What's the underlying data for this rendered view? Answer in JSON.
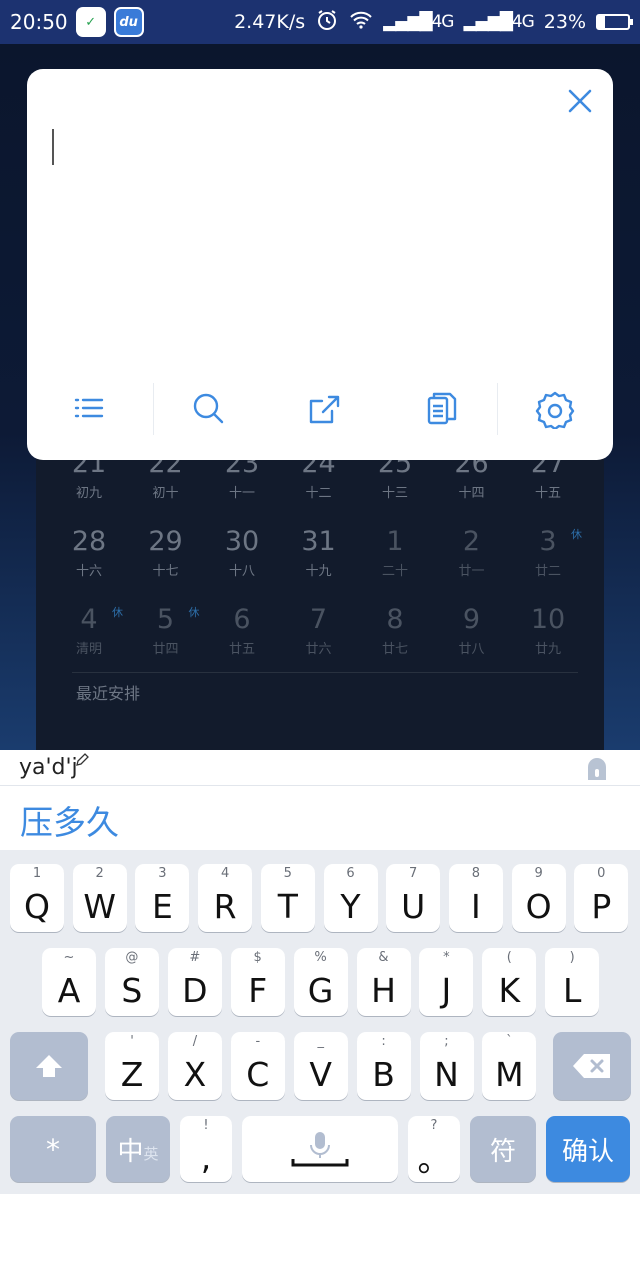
{
  "status_bar": {
    "time": "20:50",
    "app_china_mobile": "✓",
    "app_du": "du",
    "network_speed": "2.47K/s",
    "signal1": "4G",
    "signal2": "4G",
    "battery": "23%",
    "battery_level": 0.23
  },
  "calendar": {
    "rows": [
      [
        {
          "n": "21",
          "l": "初九"
        },
        {
          "n": "22",
          "l": "初十"
        },
        {
          "n": "23",
          "l": "十一"
        },
        {
          "n": "24",
          "l": "十二"
        },
        {
          "n": "25",
          "l": "十三"
        },
        {
          "n": "26",
          "l": "十四"
        },
        {
          "n": "27",
          "l": "十五"
        }
      ],
      [
        {
          "n": "28",
          "l": "十六"
        },
        {
          "n": "29",
          "l": "十七"
        },
        {
          "n": "30",
          "l": "十八"
        },
        {
          "n": "31",
          "l": "十九"
        },
        {
          "n": "1",
          "l": "二十"
        },
        {
          "n": "2",
          "l": "廿一"
        },
        {
          "n": "3",
          "l": "廿二",
          "h": "休"
        }
      ],
      [
        {
          "n": "4",
          "l": "清明",
          "h": "休"
        },
        {
          "n": "5",
          "l": "廿四",
          "h": "休"
        },
        {
          "n": "6",
          "l": "廿五"
        },
        {
          "n": "7",
          "l": "廿六"
        },
        {
          "n": "8",
          "l": "廿七"
        },
        {
          "n": "9",
          "l": "廿八"
        },
        {
          "n": "10",
          "l": "廿九"
        }
      ]
    ],
    "recent_label": "最近安排"
  },
  "note": {
    "close_icon": "close-icon",
    "tools": [
      "list-icon",
      "search-icon",
      "share-icon",
      "copy-icon",
      "settings-icon"
    ]
  },
  "ime": {
    "pinyin": "ya'd'j",
    "candidate": "压多久",
    "rows": [
      [
        {
          "k": "Q",
          "s": "1"
        },
        {
          "k": "W",
          "s": "2"
        },
        {
          "k": "E",
          "s": "3"
        },
        {
          "k": "R",
          "s": "4"
        },
        {
          "k": "T",
          "s": "5"
        },
        {
          "k": "Y",
          "s": "6"
        },
        {
          "k": "U",
          "s": "7"
        },
        {
          "k": "I",
          "s": "8"
        },
        {
          "k": "O",
          "s": "9"
        },
        {
          "k": "P",
          "s": "0"
        }
      ],
      [
        {
          "k": "A",
          "s": "~"
        },
        {
          "k": "S",
          "s": "@"
        },
        {
          "k": "D",
          "s": "#"
        },
        {
          "k": "F",
          "s": "$"
        },
        {
          "k": "G",
          "s": "%"
        },
        {
          "k": "H",
          "s": "&"
        },
        {
          "k": "J",
          "s": "*"
        },
        {
          "k": "K",
          "s": "("
        },
        {
          "k": "L",
          "s": ")"
        }
      ],
      [
        {
          "k": "Z",
          "s": "'"
        },
        {
          "k": "X",
          "s": "/"
        },
        {
          "k": "C",
          "s": "-"
        },
        {
          "k": "V",
          "s": "_"
        },
        {
          "k": "B",
          "s": ":"
        },
        {
          "k": "N",
          "s": ";"
        },
        {
          "k": "M",
          "s": "`"
        }
      ]
    ],
    "star_key": "*",
    "lang_main": "中",
    "lang_sub": "英",
    "comma_main": ",",
    "comma_sub": "!",
    "period_main": "。",
    "period_sub": "?",
    "symbol_key": "符",
    "confirm_key": "确认"
  }
}
